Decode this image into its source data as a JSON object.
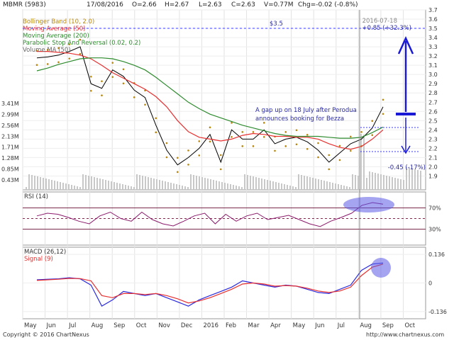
{
  "header": {
    "ticker": "MBMR (5983)",
    "date": "17/08/2016",
    "open": "O=2.66",
    "high": "H=2.67",
    "low": "L=2.63",
    "close": "C=2.63",
    "volume": "V=0.77M",
    "change": "Chg=-0.02 (-0.8%)"
  },
  "legend": {
    "items": [
      {
        "label": "Bollinger Band (10, 2.0)",
        "color": "#b8860b"
      },
      {
        "label": "Moving Average (50)",
        "color": "#e83030"
      },
      {
        "label": "Moving Average (200)",
        "color": "#2e8b2e"
      },
      {
        "label": "Parabolic Stop And Reversal (0.02, 0.2)",
        "color": "#2e8b2e"
      },
      {
        "label": "Volume MA (50)",
        "color": "#666666"
      }
    ]
  },
  "annotations": {
    "marker_date": "2016-07-18",
    "resistance": "$3.5",
    "gain": "+0.85 (+32.3%)",
    "loss": "-0.45 (-17%)",
    "note_line1": "A gap up on 18 July after Perodua",
    "note_line2": "announces booking for Bezza"
  },
  "footer": {
    "copyright": "Copyright © 2016 ChartNexus",
    "url": "http://www.chartnexus.com"
  },
  "chart_data": [
    {
      "type": "line",
      "panel": "price",
      "x": [
        "May",
        "Jun",
        "Jul",
        "Aug",
        "Sep",
        "Oct",
        "Nov",
        "Dec",
        "2016",
        "Feb",
        "Mar",
        "Apr",
        "May",
        "Jun",
        "Jul",
        "Aug",
        "Sep",
        "Oct"
      ],
      "ylim": [
        1.75,
        3.7
      ],
      "y_ticks": [
        "3.7",
        "3.6",
        "3.5",
        "3.4",
        "3.3",
        "3.2",
        "3.1",
        "3.0",
        "2.9",
        "2.8",
        "2.7",
        "2.6",
        "2.5",
        "2.4",
        "2.3",
        "2.2",
        "2.1",
        "2.0",
        "1.9"
      ],
      "volume_ticks": [
        "3.41M",
        "2.99M",
        "2.56M",
        "2.13M",
        "1.71M",
        "1.28M",
        "0.85M",
        "0.43M"
      ],
      "series": [
        {
          "name": "Close",
          "values": [
            3.18,
            3.19,
            3.21,
            3.25,
            3.3,
            2.9,
            2.85,
            3.05,
            2.98,
            2.83,
            2.75,
            2.45,
            2.18,
            2.02,
            2.1,
            2.2,
            2.35,
            2.05,
            2.4,
            2.3,
            2.3,
            2.4,
            2.25,
            2.3,
            2.32,
            2.27,
            2.18,
            2.05,
            2.15,
            2.25,
            2.3,
            2.42,
            2.65
          ]
        },
        {
          "name": "Moving Average (50)",
          "values": [
            3.25,
            3.25,
            3.24,
            3.23,
            3.21,
            3.17,
            3.1,
            3.02,
            2.96,
            2.9,
            2.84,
            2.76,
            2.65,
            2.5,
            2.38,
            2.32,
            2.3,
            2.28,
            2.3,
            2.34,
            2.36,
            2.35,
            2.33,
            2.33,
            2.32,
            2.32,
            2.3,
            2.25,
            2.21,
            2.19,
            2.22,
            2.3,
            2.4
          ]
        },
        {
          "name": "Moving Average (200)",
          "values": [
            3.04,
            3.07,
            3.11,
            3.14,
            3.17,
            3.18,
            3.18,
            3.17,
            3.14,
            3.1,
            3.05,
            2.97,
            2.88,
            2.79,
            2.7,
            2.63,
            2.57,
            2.53,
            2.49,
            2.45,
            2.42,
            2.39,
            2.36,
            2.34,
            2.33,
            2.33,
            2.33,
            2.32,
            2.31,
            2.31,
            2.32,
            2.37,
            2.43
          ]
        }
      ]
    },
    {
      "type": "line",
      "panel": "RSI",
      "title": "RSI (14)",
      "levels": [
        "70%",
        "30%"
      ],
      "ylim": [
        0,
        100
      ],
      "series": [
        {
          "name": "RSI (14)",
          "values": [
            55,
            60,
            58,
            52,
            45,
            40,
            55,
            62,
            50,
            45,
            62,
            48,
            40,
            36,
            45,
            55,
            60,
            40,
            58,
            45,
            55,
            60,
            48,
            52,
            56,
            48,
            40,
            35,
            45,
            52,
            60,
            75,
            80,
            77
          ]
        }
      ]
    },
    {
      "type": "line",
      "panel": "MACD",
      "title": "MACD (26,12)",
      "y_ticks": [
        "0.136",
        "0",
        "-0.136"
      ],
      "ylim": [
        -0.17,
        0.17
      ],
      "series": [
        {
          "name": "MACD (26,12)",
          "values": [
            0.015,
            0.018,
            0.02,
            0.025,
            0.02,
            -0.01,
            -0.11,
            -0.08,
            -0.04,
            -0.05,
            -0.06,
            -0.05,
            -0.07,
            -0.09,
            -0.11,
            -0.08,
            -0.06,
            -0.04,
            -0.02,
            0.01,
            0.0,
            -0.01,
            -0.02,
            -0.01,
            -0.015,
            -0.03,
            -0.045,
            -0.05,
            -0.03,
            -0.01,
            0.06,
            0.09,
            0.095
          ]
        },
        {
          "name": "Signal (9)",
          "values": [
            0.012,
            0.015,
            0.018,
            0.022,
            0.021,
            0.01,
            -0.06,
            -0.07,
            -0.05,
            -0.05,
            -0.055,
            -0.05,
            -0.06,
            -0.075,
            -0.095,
            -0.085,
            -0.07,
            -0.05,
            -0.03,
            -0.005,
            0.0,
            -0.005,
            -0.015,
            -0.012,
            -0.015,
            -0.025,
            -0.038,
            -0.045,
            -0.038,
            -0.02,
            0.035,
            0.075,
            0.09
          ]
        }
      ]
    }
  ]
}
